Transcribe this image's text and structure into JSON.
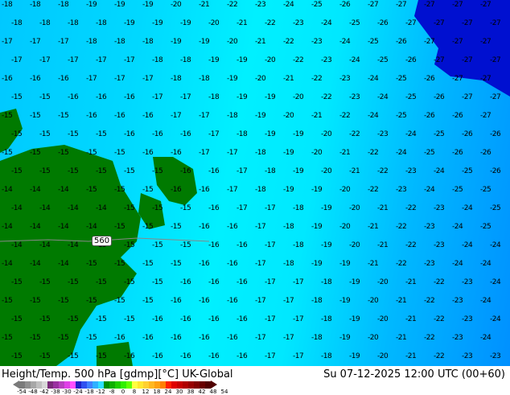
{
  "map": {
    "contour_label": "560",
    "grid_values": [
      [
        18,
        18,
        18,
        19,
        19,
        19,
        20,
        21,
        22,
        23,
        24,
        25,
        26,
        27,
        27,
        27,
        27,
        27
      ],
      [
        18,
        18,
        18,
        18,
        19,
        19,
        19,
        20,
        21,
        22,
        23,
        24,
        25,
        26,
        27,
        27,
        27,
        27
      ],
      [
        17,
        17,
        17,
        18,
        18,
        18,
        19,
        19,
        20,
        21,
        22,
        23,
        24,
        25,
        26,
        27,
        27,
        27
      ],
      [
        17,
        17,
        17,
        17,
        17,
        18,
        18,
        19,
        19,
        20,
        22,
        23,
        24,
        25,
        26,
        27,
        27,
        27
      ],
      [
        16,
        16,
        16,
        17,
        17,
        17,
        18,
        18,
        19,
        20,
        21,
        22,
        23,
        24,
        25,
        26,
        27,
        27
      ],
      [
        15,
        15,
        16,
        16,
        16,
        17,
        17,
        18,
        19,
        19,
        20,
        22,
        23,
        24,
        25,
        26,
        27,
        27
      ],
      [
        15,
        15,
        15,
        16,
        16,
        16,
        17,
        17,
        18,
        19,
        20,
        21,
        22,
        24,
        25,
        26,
        26,
        27
      ],
      [
        15,
        15,
        15,
        15,
        16,
        16,
        16,
        17,
        18,
        19,
        19,
        20,
        22,
        23,
        24,
        25,
        26,
        26
      ],
      [
        15,
        15,
        15,
        15,
        15,
        16,
        16,
        17,
        17,
        18,
        19,
        20,
        21,
        22,
        24,
        25,
        26,
        26
      ],
      [
        15,
        15,
        15,
        15,
        15,
        15,
        16,
        16,
        17,
        18,
        19,
        20,
        21,
        22,
        23,
        24,
        25,
        26
      ],
      [
        14,
        14,
        14,
        15,
        15,
        15,
        16,
        16,
        17,
        18,
        19,
        19,
        20,
        22,
        23,
        24,
        25,
        25
      ],
      [
        14,
        14,
        14,
        14,
        15,
        15,
        15,
        16,
        17,
        17,
        18,
        19,
        20,
        21,
        22,
        23,
        24,
        25
      ],
      [
        14,
        14,
        14,
        14,
        15,
        15,
        15,
        16,
        16,
        17,
        18,
        19,
        20,
        21,
        22,
        23,
        24,
        25
      ],
      [
        14,
        14,
        14,
        15,
        15,
        15,
        15,
        16,
        16,
        17,
        18,
        19,
        20,
        21,
        22,
        23,
        24,
        24
      ],
      [
        14,
        14,
        14,
        15,
        15,
        15,
        15,
        16,
        16,
        17,
        18,
        19,
        19,
        21,
        22,
        23,
        24,
        24
      ],
      [
        15,
        15,
        15,
        15,
        15,
        15,
        16,
        16,
        16,
        17,
        17,
        18,
        19,
        20,
        21,
        22,
        23,
        24
      ],
      [
        15,
        15,
        15,
        15,
        15,
        15,
        16,
        16,
        16,
        17,
        17,
        18,
        19,
        20,
        21,
        22,
        23,
        24
      ],
      [
        15,
        15,
        15,
        15,
        15,
        16,
        16,
        16,
        16,
        17,
        17,
        18,
        19,
        20,
        21,
        22,
        23,
        24
      ],
      [
        15,
        15,
        15,
        15,
        16,
        16,
        16,
        16,
        16,
        17,
        17,
        18,
        19,
        20,
        21,
        22,
        23,
        24
      ],
      [
        15,
        15,
        15,
        15,
        16,
        16,
        16,
        16,
        16,
        17,
        17,
        18,
        19,
        20,
        21,
        22,
        23,
        23
      ]
    ],
    "value_sign": "-",
    "land_color": "#007a00",
    "cold_color": "#0010d0"
  },
  "footer": {
    "title": "Height/Temp. 500 hPa [gdmp][°C] UK-Global",
    "datetime": "Su 07-12-2025 12:00 UTC (00+60)",
    "scale_ticks": [
      "-54",
      "-48",
      "-42",
      "-38",
      "-30",
      "-24",
      "-18",
      "-12",
      "-8",
      "0",
      "8",
      "12",
      "18",
      "24",
      "30",
      "38",
      "42",
      "48",
      "54"
    ],
    "scale_colors": [
      "#7a7a7a",
      "#909090",
      "#a8a8a8",
      "#c0c0c0",
      "#d8d8d8",
      "#7a2a7a",
      "#9a30a0",
      "#b840c0",
      "#e040e8",
      "#ff50ff",
      "#2020c8",
      "#3050f0",
      "#4080ff",
      "#30b0ff",
      "#30e0ff",
      "#009000",
      "#10b000",
      "#20d000",
      "#30f000",
      "#60ff00",
      "#ffff40",
      "#ffe830",
      "#ffd030",
      "#ffb820",
      "#ffa010",
      "#ff8000",
      "#ff2000",
      "#e00000",
      "#c80000",
      "#b00000",
      "#980000",
      "#800000",
      "#680000",
      "#500000"
    ]
  }
}
